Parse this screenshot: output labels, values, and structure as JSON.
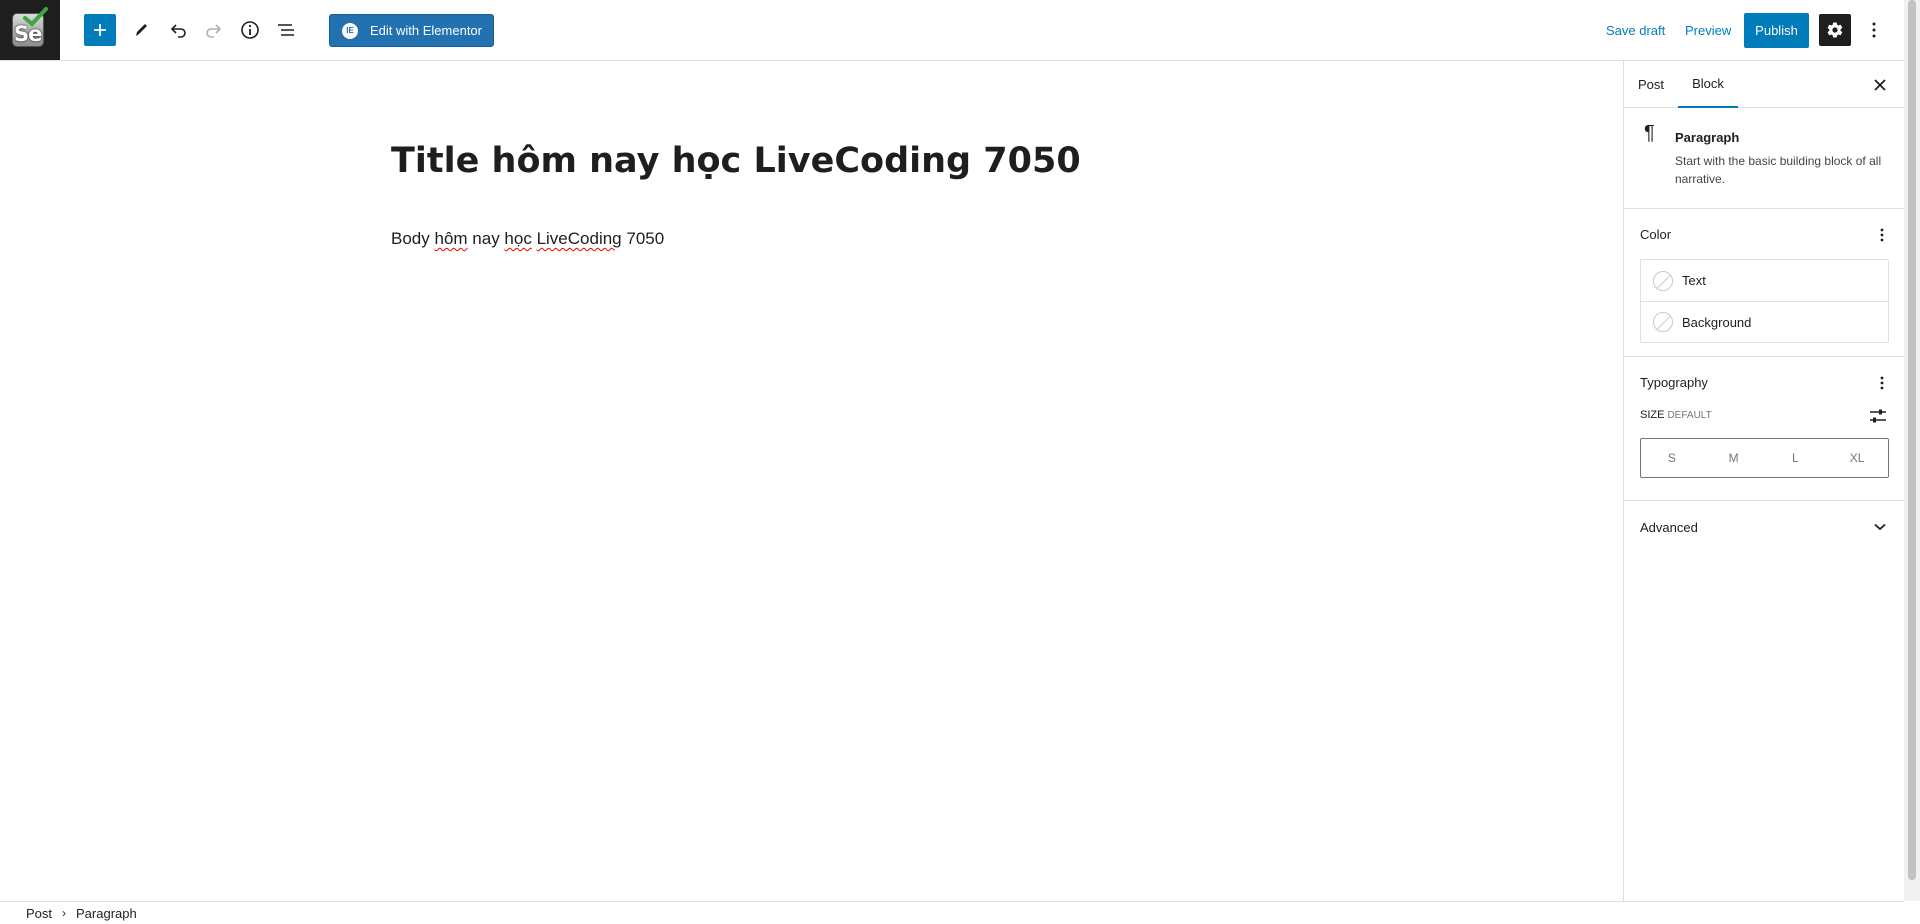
{
  "app": {
    "logo_text": "Se"
  },
  "toolbar": {
    "elementor_label": "Edit with Elementor",
    "elementor_icon_text": "IE",
    "save_draft_label": "Save draft",
    "preview_label": "Preview",
    "publish_label": "Publish",
    "accent_color": "#007cba"
  },
  "post": {
    "title": "Title hôm nay học LiveCoding 7050",
    "body_parts": [
      "Body ",
      "hôm",
      " nay ",
      "học",
      " ",
      "LiveCoding",
      " 7050"
    ]
  },
  "sidebar": {
    "tabs": [
      {
        "label": "Post"
      },
      {
        "label": "Block"
      }
    ],
    "active_tab": "Block",
    "block": {
      "name": "Paragraph",
      "description": "Start with the basic building block of all narrative.",
      "icon": "pilcrow-icon"
    },
    "color": {
      "title": "Color",
      "items": [
        {
          "label": "Text"
        },
        {
          "label": "Background"
        }
      ]
    },
    "typography": {
      "title": "Typography",
      "size_label": "SIZE",
      "size_value": "DEFAULT",
      "size_options": [
        "S",
        "M",
        "L",
        "XL"
      ]
    },
    "advanced": {
      "title": "Advanced"
    }
  },
  "footer": {
    "breadcrumb": [
      "Post",
      "Paragraph"
    ]
  }
}
